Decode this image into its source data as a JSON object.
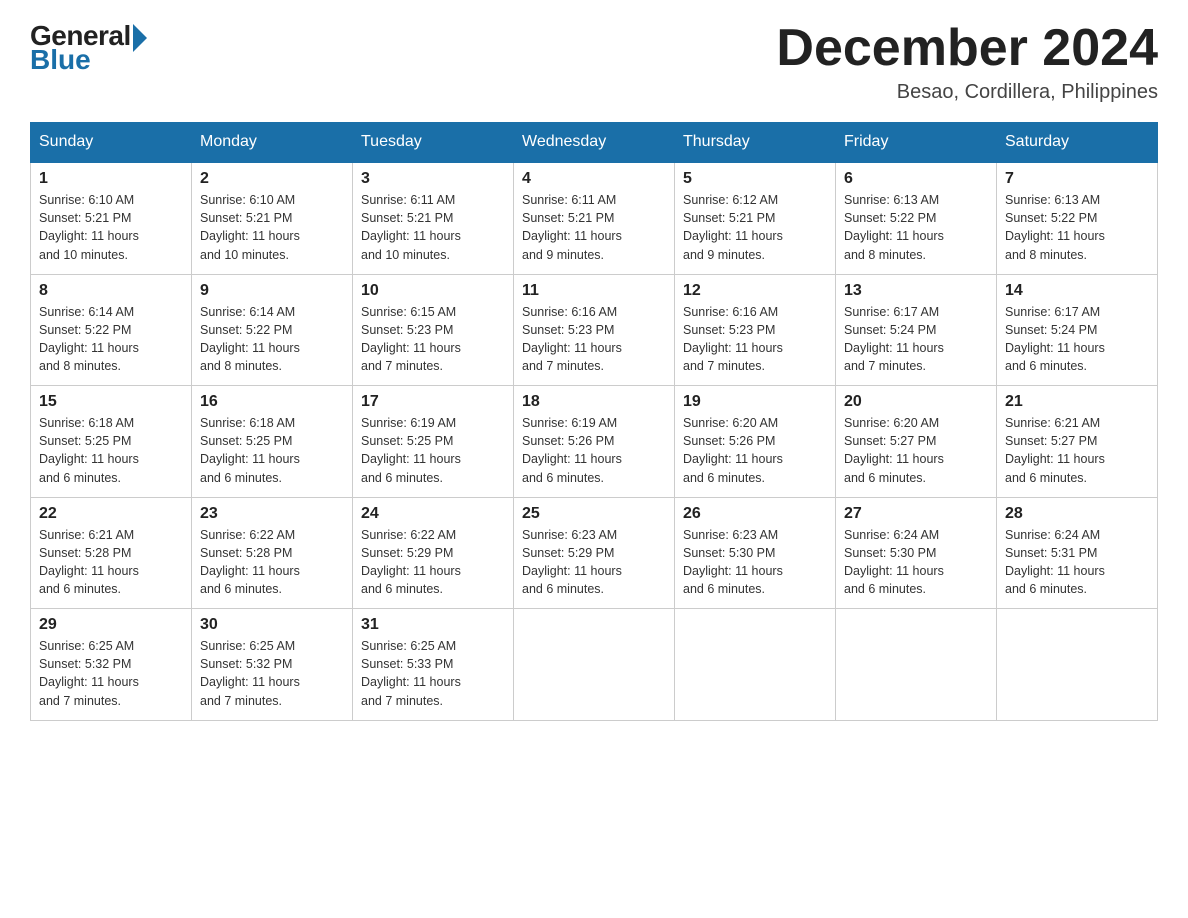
{
  "logo": {
    "general": "General",
    "blue": "Blue"
  },
  "title": "December 2024",
  "subtitle": "Besao, Cordillera, Philippines",
  "days_of_week": [
    "Sunday",
    "Monday",
    "Tuesday",
    "Wednesday",
    "Thursday",
    "Friday",
    "Saturday"
  ],
  "weeks": [
    [
      {
        "day": "1",
        "info": "Sunrise: 6:10 AM\nSunset: 5:21 PM\nDaylight: 11 hours\nand 10 minutes."
      },
      {
        "day": "2",
        "info": "Sunrise: 6:10 AM\nSunset: 5:21 PM\nDaylight: 11 hours\nand 10 minutes."
      },
      {
        "day": "3",
        "info": "Sunrise: 6:11 AM\nSunset: 5:21 PM\nDaylight: 11 hours\nand 10 minutes."
      },
      {
        "day": "4",
        "info": "Sunrise: 6:11 AM\nSunset: 5:21 PM\nDaylight: 11 hours\nand 9 minutes."
      },
      {
        "day": "5",
        "info": "Sunrise: 6:12 AM\nSunset: 5:21 PM\nDaylight: 11 hours\nand 9 minutes."
      },
      {
        "day": "6",
        "info": "Sunrise: 6:13 AM\nSunset: 5:22 PM\nDaylight: 11 hours\nand 8 minutes."
      },
      {
        "day": "7",
        "info": "Sunrise: 6:13 AM\nSunset: 5:22 PM\nDaylight: 11 hours\nand 8 minutes."
      }
    ],
    [
      {
        "day": "8",
        "info": "Sunrise: 6:14 AM\nSunset: 5:22 PM\nDaylight: 11 hours\nand 8 minutes."
      },
      {
        "day": "9",
        "info": "Sunrise: 6:14 AM\nSunset: 5:22 PM\nDaylight: 11 hours\nand 8 minutes."
      },
      {
        "day": "10",
        "info": "Sunrise: 6:15 AM\nSunset: 5:23 PM\nDaylight: 11 hours\nand 7 minutes."
      },
      {
        "day": "11",
        "info": "Sunrise: 6:16 AM\nSunset: 5:23 PM\nDaylight: 11 hours\nand 7 minutes."
      },
      {
        "day": "12",
        "info": "Sunrise: 6:16 AM\nSunset: 5:23 PM\nDaylight: 11 hours\nand 7 minutes."
      },
      {
        "day": "13",
        "info": "Sunrise: 6:17 AM\nSunset: 5:24 PM\nDaylight: 11 hours\nand 7 minutes."
      },
      {
        "day": "14",
        "info": "Sunrise: 6:17 AM\nSunset: 5:24 PM\nDaylight: 11 hours\nand 6 minutes."
      }
    ],
    [
      {
        "day": "15",
        "info": "Sunrise: 6:18 AM\nSunset: 5:25 PM\nDaylight: 11 hours\nand 6 minutes."
      },
      {
        "day": "16",
        "info": "Sunrise: 6:18 AM\nSunset: 5:25 PM\nDaylight: 11 hours\nand 6 minutes."
      },
      {
        "day": "17",
        "info": "Sunrise: 6:19 AM\nSunset: 5:25 PM\nDaylight: 11 hours\nand 6 minutes."
      },
      {
        "day": "18",
        "info": "Sunrise: 6:19 AM\nSunset: 5:26 PM\nDaylight: 11 hours\nand 6 minutes."
      },
      {
        "day": "19",
        "info": "Sunrise: 6:20 AM\nSunset: 5:26 PM\nDaylight: 11 hours\nand 6 minutes."
      },
      {
        "day": "20",
        "info": "Sunrise: 6:20 AM\nSunset: 5:27 PM\nDaylight: 11 hours\nand 6 minutes."
      },
      {
        "day": "21",
        "info": "Sunrise: 6:21 AM\nSunset: 5:27 PM\nDaylight: 11 hours\nand 6 minutes."
      }
    ],
    [
      {
        "day": "22",
        "info": "Sunrise: 6:21 AM\nSunset: 5:28 PM\nDaylight: 11 hours\nand 6 minutes."
      },
      {
        "day": "23",
        "info": "Sunrise: 6:22 AM\nSunset: 5:28 PM\nDaylight: 11 hours\nand 6 minutes."
      },
      {
        "day": "24",
        "info": "Sunrise: 6:22 AM\nSunset: 5:29 PM\nDaylight: 11 hours\nand 6 minutes."
      },
      {
        "day": "25",
        "info": "Sunrise: 6:23 AM\nSunset: 5:29 PM\nDaylight: 11 hours\nand 6 minutes."
      },
      {
        "day": "26",
        "info": "Sunrise: 6:23 AM\nSunset: 5:30 PM\nDaylight: 11 hours\nand 6 minutes."
      },
      {
        "day": "27",
        "info": "Sunrise: 6:24 AM\nSunset: 5:30 PM\nDaylight: 11 hours\nand 6 minutes."
      },
      {
        "day": "28",
        "info": "Sunrise: 6:24 AM\nSunset: 5:31 PM\nDaylight: 11 hours\nand 6 minutes."
      }
    ],
    [
      {
        "day": "29",
        "info": "Sunrise: 6:25 AM\nSunset: 5:32 PM\nDaylight: 11 hours\nand 7 minutes."
      },
      {
        "day": "30",
        "info": "Sunrise: 6:25 AM\nSunset: 5:32 PM\nDaylight: 11 hours\nand 7 minutes."
      },
      {
        "day": "31",
        "info": "Sunrise: 6:25 AM\nSunset: 5:33 PM\nDaylight: 11 hours\nand 7 minutes."
      },
      {
        "day": "",
        "info": ""
      },
      {
        "day": "",
        "info": ""
      },
      {
        "day": "",
        "info": ""
      },
      {
        "day": "",
        "info": ""
      }
    ]
  ]
}
